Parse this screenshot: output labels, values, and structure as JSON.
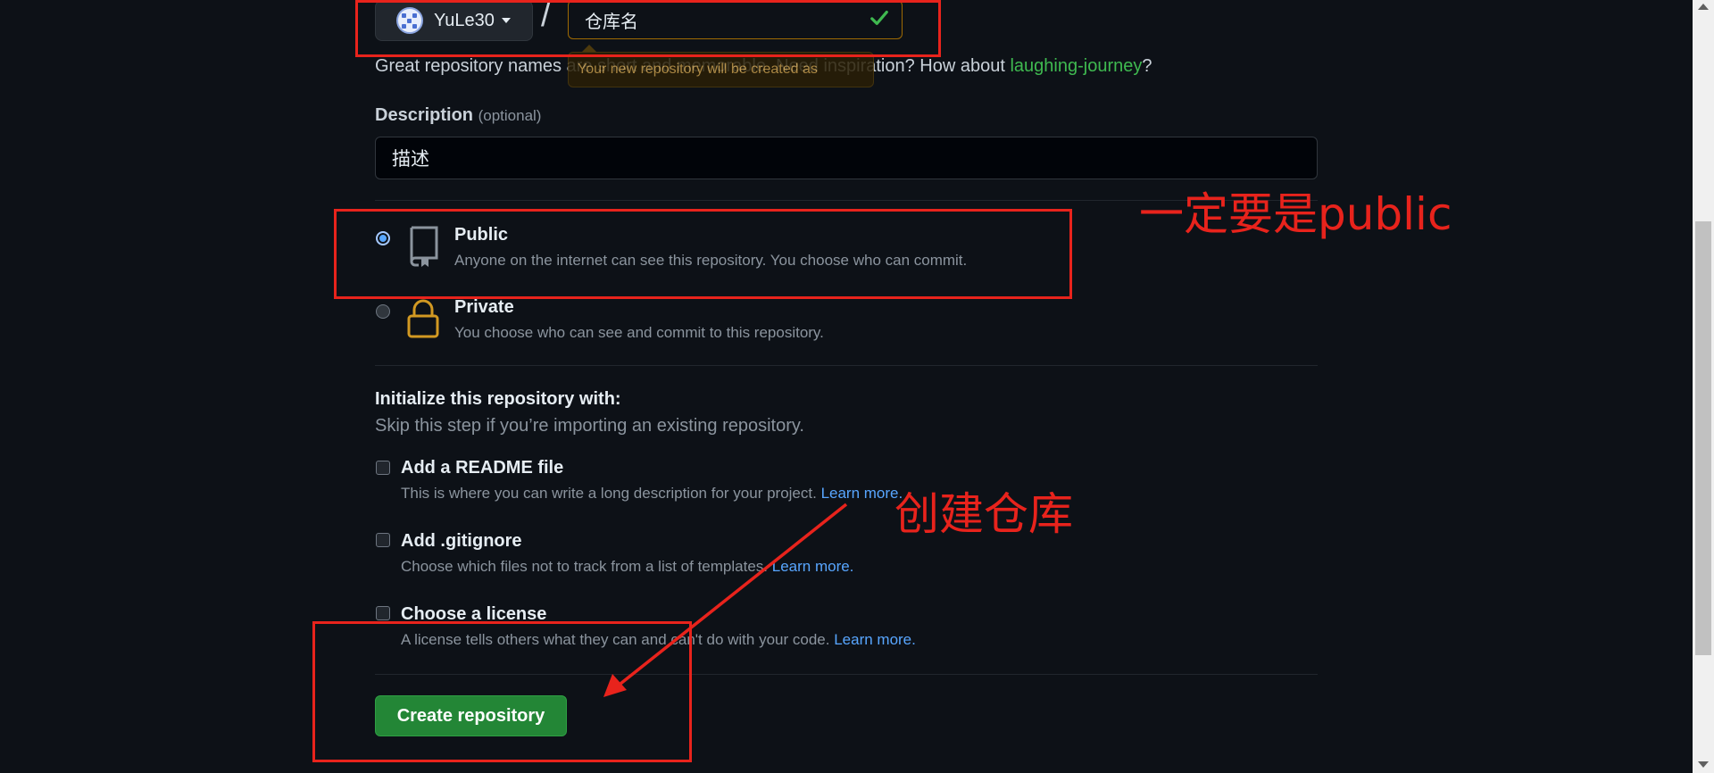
{
  "owner": {
    "name": "YuLe30",
    "avatar_icon": "identicon-avatar"
  },
  "separator": "/",
  "repo_name": {
    "value": "仓库名",
    "tooltip": "Your new repository will be created as"
  },
  "name_hint": {
    "text": "Great repository names are short and memorable. Need inspiration? How about ",
    "suggestion": "laughing-journey",
    "end": "?"
  },
  "description": {
    "label": "Description",
    "optional": "(optional)",
    "value": "描述"
  },
  "visibility": {
    "public": {
      "title": "Public",
      "subtitle": "Anyone on the internet can see this repository. You choose who can commit.",
      "selected": true,
      "icon": "repo-icon"
    },
    "private": {
      "title": "Private",
      "subtitle": "You choose who can see and commit to this repository.",
      "selected": false,
      "icon": "lock-icon"
    }
  },
  "initialize": {
    "title": "Initialize this repository with:",
    "subtitle": "Skip this step if you’re importing an existing repository.",
    "options": [
      {
        "title": "Add a README file",
        "subtitle": "This is where you can write a long description for your project.",
        "link": "Learn more."
      },
      {
        "title": "Add .gitignore",
        "subtitle": "Choose which files not to track from a list of templates.",
        "link": "Learn more."
      },
      {
        "title": "Choose a license",
        "subtitle": "A license tells others what they can and can't do with your code.",
        "link": "Learn more."
      }
    ]
  },
  "create_button": "Create repository",
  "annotations": {
    "public_note": "一定要是public",
    "create_note": "创建仓库"
  },
  "colors": {
    "background": "#0d1117",
    "accent_green": "#238636",
    "link_blue": "#58a6ff",
    "annotation_red": "#e8231c"
  }
}
